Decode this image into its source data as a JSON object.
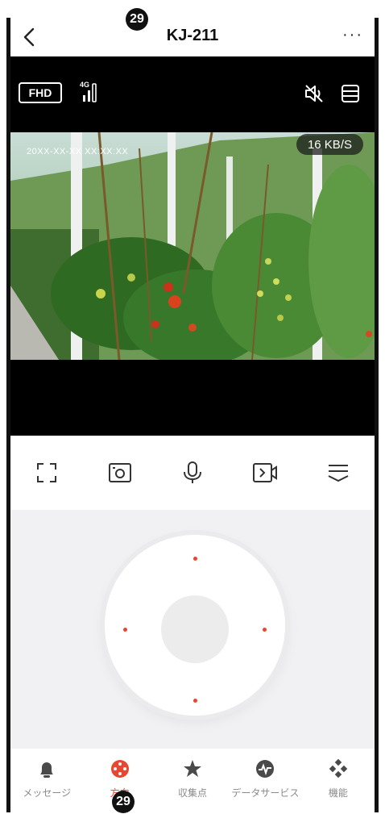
{
  "callouts": {
    "top": "29",
    "bottom": "29"
  },
  "header": {
    "title": "KJ-211",
    "more": "···"
  },
  "stream": {
    "quality": "FHD",
    "network": "4G",
    "timestamp": "20XX-XX-XX XX:XX:XX",
    "rate": "16 KB/S"
  },
  "controls": [
    {
      "name": "fullscreen-icon"
    },
    {
      "name": "screenshot-icon"
    },
    {
      "name": "microphone-icon"
    },
    {
      "name": "record-icon"
    },
    {
      "name": "menu-collapse-icon"
    }
  ],
  "tabs": [
    {
      "label": "メッセージ",
      "icon": "bell-icon"
    },
    {
      "label": "方向",
      "icon": "direction-icon"
    },
    {
      "label": "収集点",
      "icon": "star-icon"
    },
    {
      "label": "データサービス",
      "icon": "pulse-icon"
    },
    {
      "label": "機能",
      "icon": "diamonds-icon"
    }
  ],
  "colors": {
    "accent": "#e8462f",
    "tab_inactive": "#8a8a8a"
  }
}
